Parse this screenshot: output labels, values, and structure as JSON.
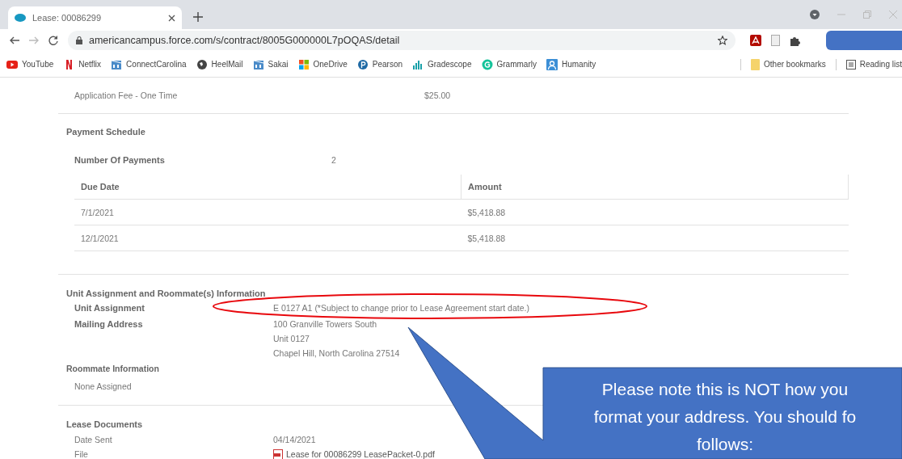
{
  "browser": {
    "tabs": [
      {
        "title": "Lease: 00086299",
        "selected": true
      }
    ],
    "url": "americancampus.force.com/s/contract/8005G000000L7pOQAS/detail",
    "bookmarks": [
      {
        "label": "YouTube",
        "kind": "play"
      },
      {
        "label": "Netflix",
        "kind": "letter-n"
      },
      {
        "label": "ConnectCarolina",
        "kind": "building"
      },
      {
        "label": "HeelMail",
        "kind": "globe"
      },
      {
        "label": "Sakai",
        "kind": "building"
      },
      {
        "label": "OneDrive",
        "kind": "tiles"
      },
      {
        "label": "Pearson",
        "kind": "circle-p"
      },
      {
        "label": "Gradescope",
        "kind": "bars"
      },
      {
        "label": "Grammarly",
        "kind": "circle-g"
      },
      {
        "label": "Humanity",
        "kind": "person"
      }
    ],
    "other_bookmarks": "Other bookmarks",
    "reading_list": "Reading list"
  },
  "fees": [
    {
      "label": "Application Fee - One Time",
      "amount": "$25.00"
    }
  ],
  "payment_schedule": {
    "title": "Payment Schedule",
    "count_label": "Number Of Payments",
    "count": "2",
    "columns": [
      "Due Date",
      "Amount"
    ],
    "rows": [
      [
        "7/1/2021",
        "$5,418.88"
      ],
      [
        "12/1/2021",
        "$5,418.88"
      ]
    ]
  },
  "unit": {
    "title": "Unit Assignment and Roommate(s) Information",
    "fields": [
      {
        "label": "Unit Assignment",
        "lines": [
          "E 0127 A1 (*Subject to change prior to Lease Agreement start date.)"
        ]
      },
      {
        "label": "Mailing Address",
        "lines": [
          "100 Granville Towers South",
          "Unit 0127",
          "Chapel Hill, North Carolina 27514"
        ]
      }
    ],
    "roommate_title": "Roommate Information",
    "roommate_value": "None Assigned"
  },
  "documents": {
    "title": "Lease Documents",
    "date_label": "Date Sent",
    "date": "04/14/2021",
    "file_label": "File",
    "file": "Lease for 00086299 LeasePacket-0.pdf"
  },
  "annotation": {
    "callout": [
      "Please note this is NOT how you",
      "format your address. You should fo",
      "follows:"
    ]
  }
}
